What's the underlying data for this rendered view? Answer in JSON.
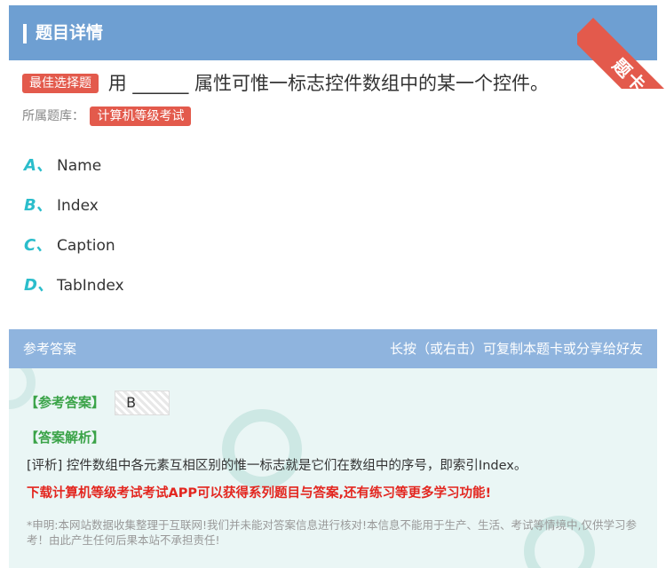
{
  "header": {
    "title": "题目详情"
  },
  "corner_ribbon": {
    "label": "题卡"
  },
  "question": {
    "type_tag": "最佳选择题",
    "text": "用 ______ 属性可惟一标志控件数组中的某一个控件。"
  },
  "source": {
    "label": "所属题库：",
    "tag": "计算机等级考试"
  },
  "options": [
    {
      "letter": "A、",
      "text": "Name"
    },
    {
      "letter": "B、",
      "text": "Index"
    },
    {
      "letter": "C、",
      "text": "Caption"
    },
    {
      "letter": "D、",
      "text": "TabIndex"
    }
  ],
  "answer_panel": {
    "title": "参考答案",
    "hint": "长按（或右击）可复制本题卡或分享给好友",
    "answer_label": "【参考答案】",
    "answer_value": "B",
    "analysis_label": "【答案解析】",
    "analysis_text": "[评析] 控件数组中各元素互相区别的惟一标志就是它们在数组中的序号，即索引Index。",
    "promo_text": "下载计算机等级考试考试APP可以获得系列题目与答案,还有练习等更多学习功能!",
    "disclaimer": "*申明:本网站数据收集整理于互联网!我们并未能对答案信息进行核对!本信息不能用于生产、生活、考试等情境中,仅供学习参考！由此产生任何后果本站不承担责任!"
  },
  "colors": {
    "header_bg": "#6e9fd2",
    "tag_red": "#e35a4c",
    "option_letter": "#2bbdcb",
    "answer_green": "#3aa348",
    "promo_red": "#e3261f"
  }
}
